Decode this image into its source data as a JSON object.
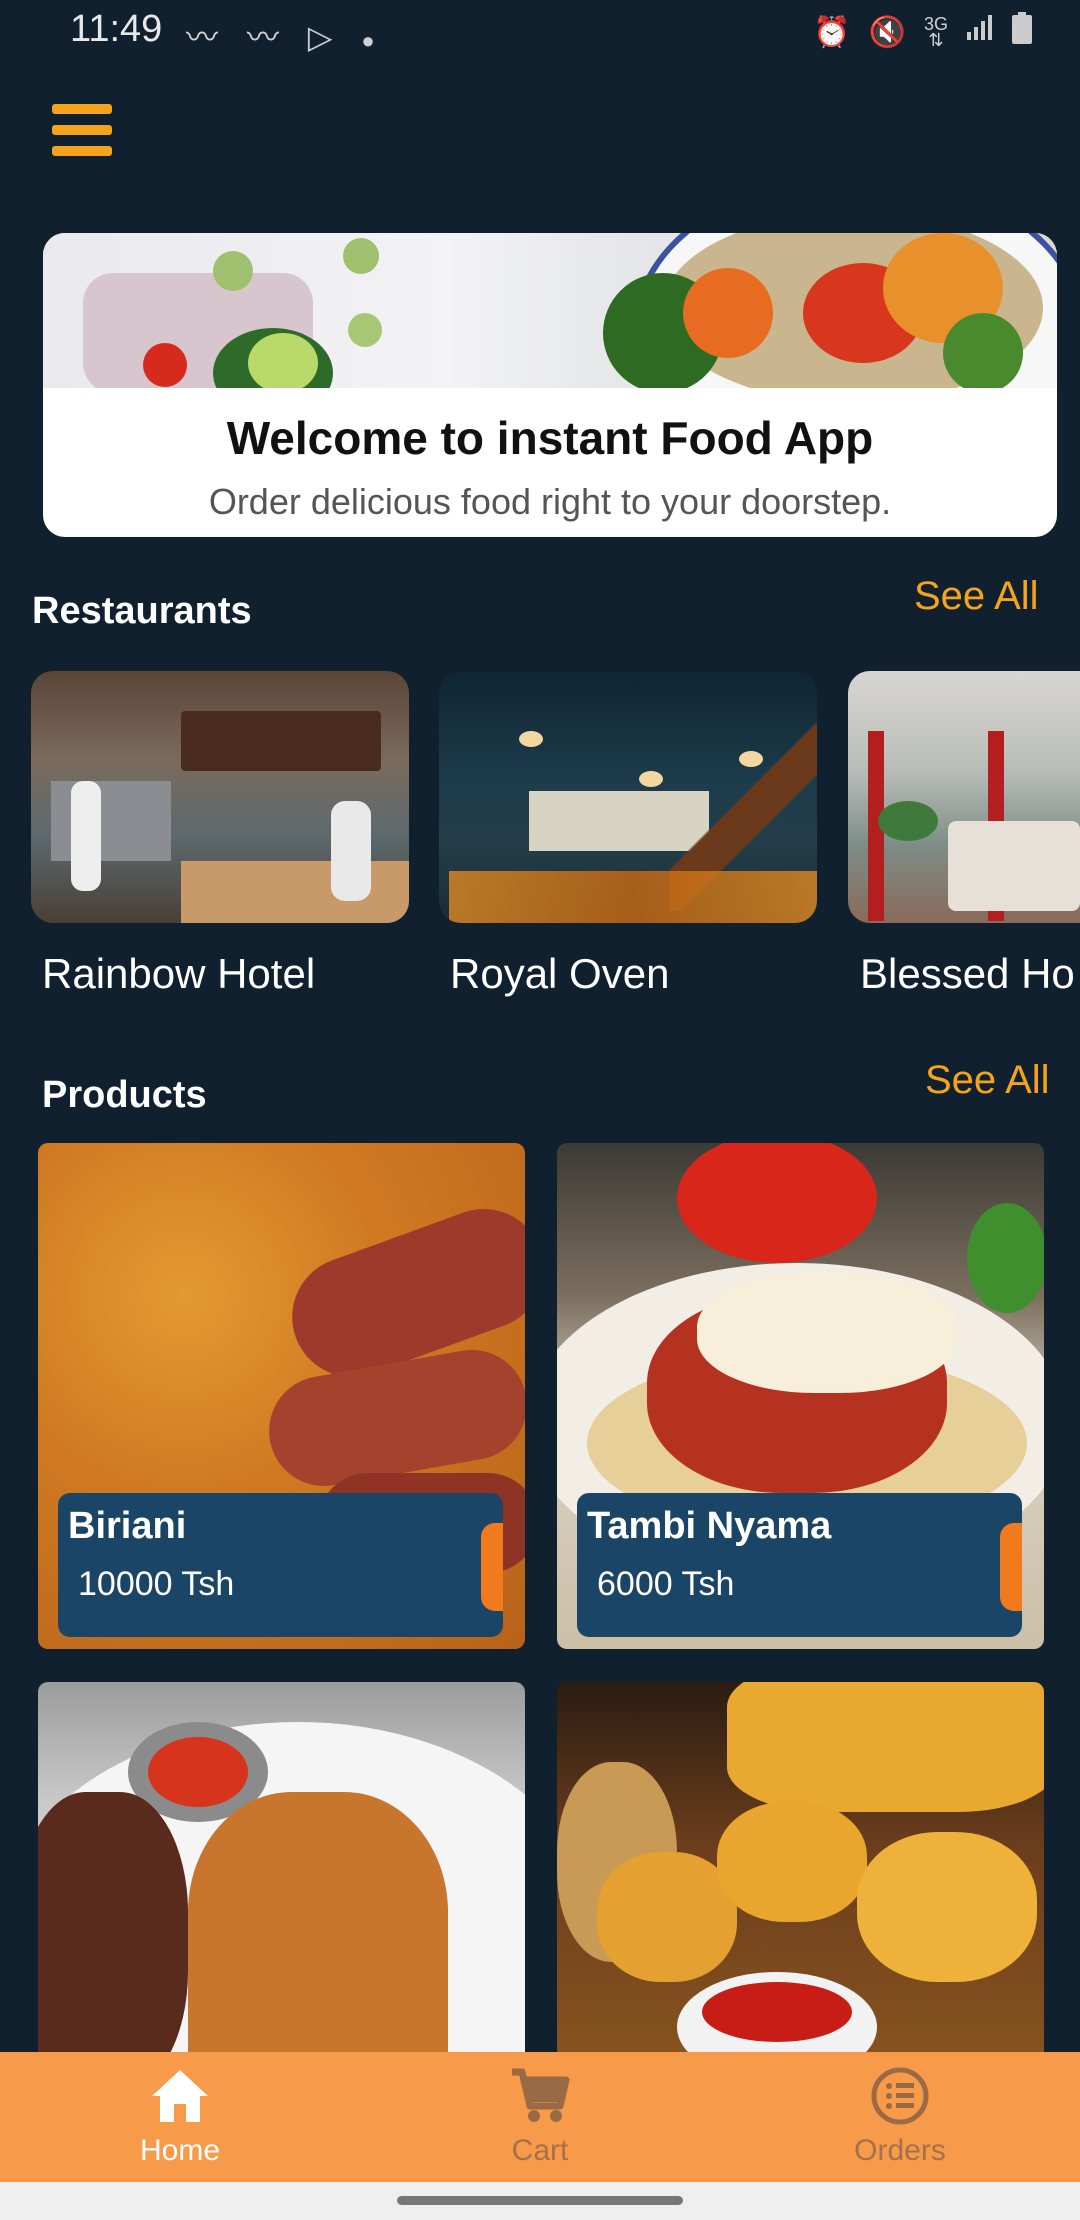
{
  "status_bar": {
    "time": "11:49",
    "left_icons": [
      "waveform-icon",
      "waveform-icon",
      "play-store-icon",
      "dot-icon"
    ],
    "right_icons": [
      "alarm-icon",
      "mute-icon",
      "network-3g-icon",
      "signal-icon",
      "battery-icon"
    ],
    "network": "3G"
  },
  "header": {
    "menu_icon": "hamburger-menu-icon"
  },
  "welcome": {
    "title": "Welcome to instant Food App",
    "subtitle": "Order delicious food right to your doorstep."
  },
  "restaurants": {
    "title": "Restaurants",
    "see_all": "See All",
    "items": [
      {
        "name": "Rainbow Hotel"
      },
      {
        "name": "Royal Oven"
      },
      {
        "name": "Blessed Ho"
      }
    ]
  },
  "products": {
    "title": "Products",
    "see_all": "See All",
    "items": [
      {
        "name": "Biriani",
        "price": "10000 Tsh"
      },
      {
        "name": "Tambi Nyama",
        "price": "6000 Tsh"
      }
    ]
  },
  "bottom_nav": {
    "items": [
      {
        "label": "Home",
        "icon": "home-icon",
        "active": true
      },
      {
        "label": "Cart",
        "icon": "cart-icon",
        "active": false
      },
      {
        "label": "Orders",
        "icon": "orders-list-icon",
        "active": false
      }
    ]
  },
  "colors": {
    "background": "#10202f",
    "accent": "#f5a31a",
    "nav_bar": "#f79a4a",
    "product_info": "#1b4566",
    "product_handle": "#f07a1d"
  }
}
